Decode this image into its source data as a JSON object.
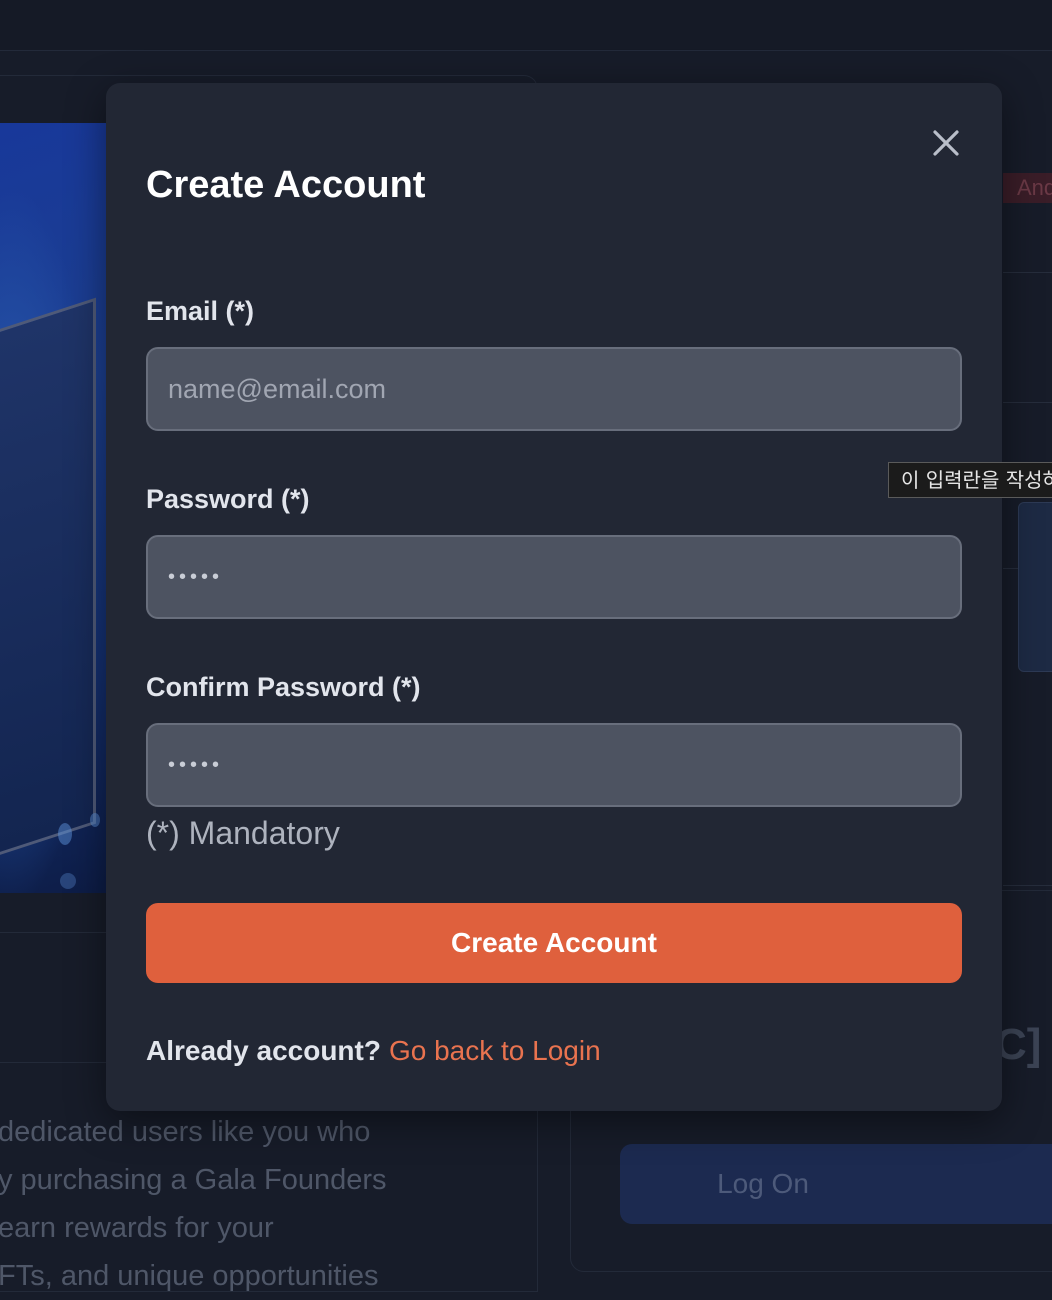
{
  "modal": {
    "title": "Create Account",
    "close_icon": "close-icon",
    "fields": {
      "email": {
        "label": "Email (*)",
        "placeholder": "name@email.com",
        "value": ""
      },
      "password": {
        "label": "Password (*)",
        "value": "•••••"
      },
      "confirm_password": {
        "label": "Confirm Password (*)",
        "value": "•••••"
      }
    },
    "mandatory_note": "(*) Mandatory",
    "submit_label": "Create Account",
    "login_prompt": {
      "question": "Already account?",
      "link_label": "Go back to Login"
    }
  },
  "tooltip": {
    "text": "이 입력란을 작성하"
  },
  "background": {
    "badge_text": "And",
    "description": "dedicated users like you who\ny purchasing a Gala Founders\n earn rewards for your\nFTs, and unique opportunities",
    "bracket_text": "C]",
    "logon_label": "Log On"
  },
  "colors": {
    "page_bg": "#171c29",
    "modal_bg": "#222734",
    "input_bg": "#4d5361",
    "accent": "#df603d",
    "link": "#e9734f"
  }
}
